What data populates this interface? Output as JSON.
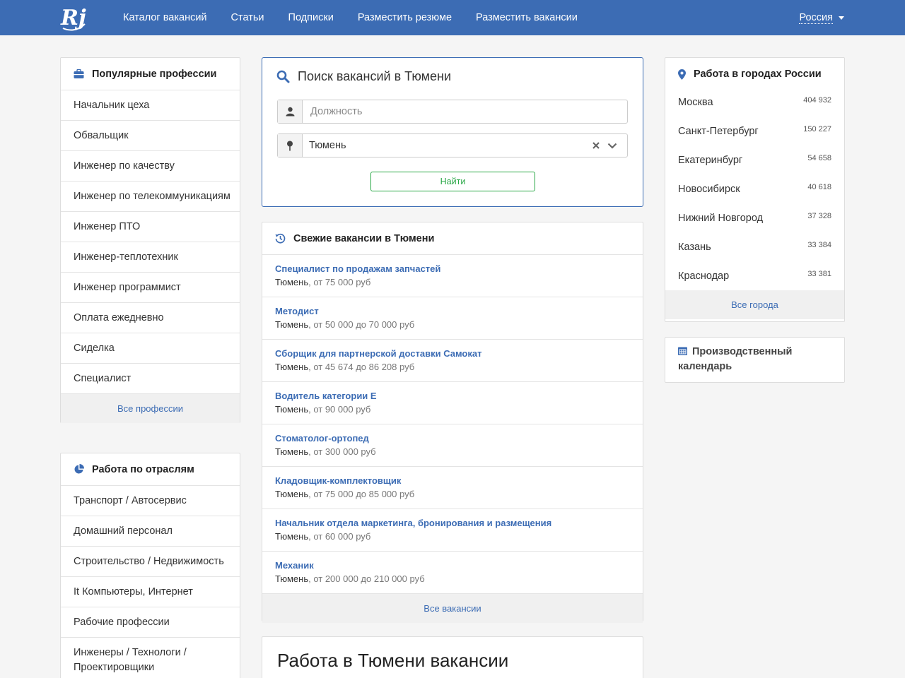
{
  "nav": {
    "logo_text": "Rj",
    "links": [
      "Каталог вакансий",
      "Статьи",
      "Подписки",
      "Разместить резюме",
      "Разместить вакансии"
    ],
    "region": "Россия"
  },
  "colors": {
    "brand": "#3c6cb4",
    "accent_green": "#28a745"
  },
  "professions": {
    "title": "Популярные профессии",
    "icon": "briefcase-icon",
    "items": [
      "Начальник цеха",
      "Обвальщик",
      "Инженер по качеству",
      "Инженер по телекоммуникациям",
      "Инженер ПТО",
      "Инженер-теплотехник",
      "Инженер программист",
      "Оплата ежедневно",
      "Сиделка",
      "Специалист"
    ],
    "footer": "Все профессии"
  },
  "industries": {
    "title": "Работа по отраслям",
    "icon": "pie-chart-icon",
    "items": [
      "Транспорт / Автосервис",
      "Домашний персонал",
      "Строительство / Недвижимость",
      "It Компьютеры, Интернет",
      "Рабочие профессии",
      "Инженеры / Технологи / Проектировщики"
    ]
  },
  "search": {
    "title": "Поиск вакансий в Тюмени",
    "position_placeholder": "Должность",
    "city_value": "Тюмень",
    "button": "Найти"
  },
  "fresh": {
    "title": "Свежие вакансии в Тюмени",
    "icon": "history-icon",
    "items": [
      {
        "title": "Специалист по продажам запчастей",
        "city": "Тюмень",
        "salary": ", от 75 000 руб"
      },
      {
        "title": "Методист",
        "city": "Тюмень",
        "salary": ", от 50 000 до 70 000 руб"
      },
      {
        "title": "Сборщик для партнерской доставки Самокат",
        "city": "Тюмень",
        "salary": ", от 45 674 до 86 208 руб"
      },
      {
        "title": "Водитель категории Е",
        "city": "Тюмень",
        "salary": ", от 90 000 руб"
      },
      {
        "title": "Стоматолог-ортопед",
        "city": "Тюмень",
        "salary": ", от 300 000 руб"
      },
      {
        "title": "Кладовщик-комплектовщик",
        "city": "Тюмень",
        "salary": ", от 75 000 до 85 000 руб"
      },
      {
        "title": "Начальник отдела маркетинга, бронирования и размещения",
        "city": "Тюмень",
        "salary": ", от 60 000 руб"
      },
      {
        "title": "Механик",
        "city": "Тюмень",
        "salary": ", от 200 000 до 210 000 руб"
      }
    ],
    "footer": "Все вакансии"
  },
  "main_title": "Работа в Тюмени вакансии",
  "cities": {
    "title": "Работа в городах России",
    "icon": "map-marker-icon",
    "items": [
      {
        "name": "Москва",
        "count": "404 932"
      },
      {
        "name": "Санкт-Петербург",
        "count": "150 227"
      },
      {
        "name": "Екатеринбург",
        "count": "54 658"
      },
      {
        "name": "Новосибирск",
        "count": "40 618"
      },
      {
        "name": "Нижний Новгород",
        "count": "37 328"
      },
      {
        "name": "Казань",
        "count": "33 384"
      },
      {
        "name": "Краснодар",
        "count": "33 381"
      }
    ],
    "footer": "Все города"
  },
  "calendar": {
    "title": "Производственный календарь",
    "icon": "calendar-icon"
  }
}
